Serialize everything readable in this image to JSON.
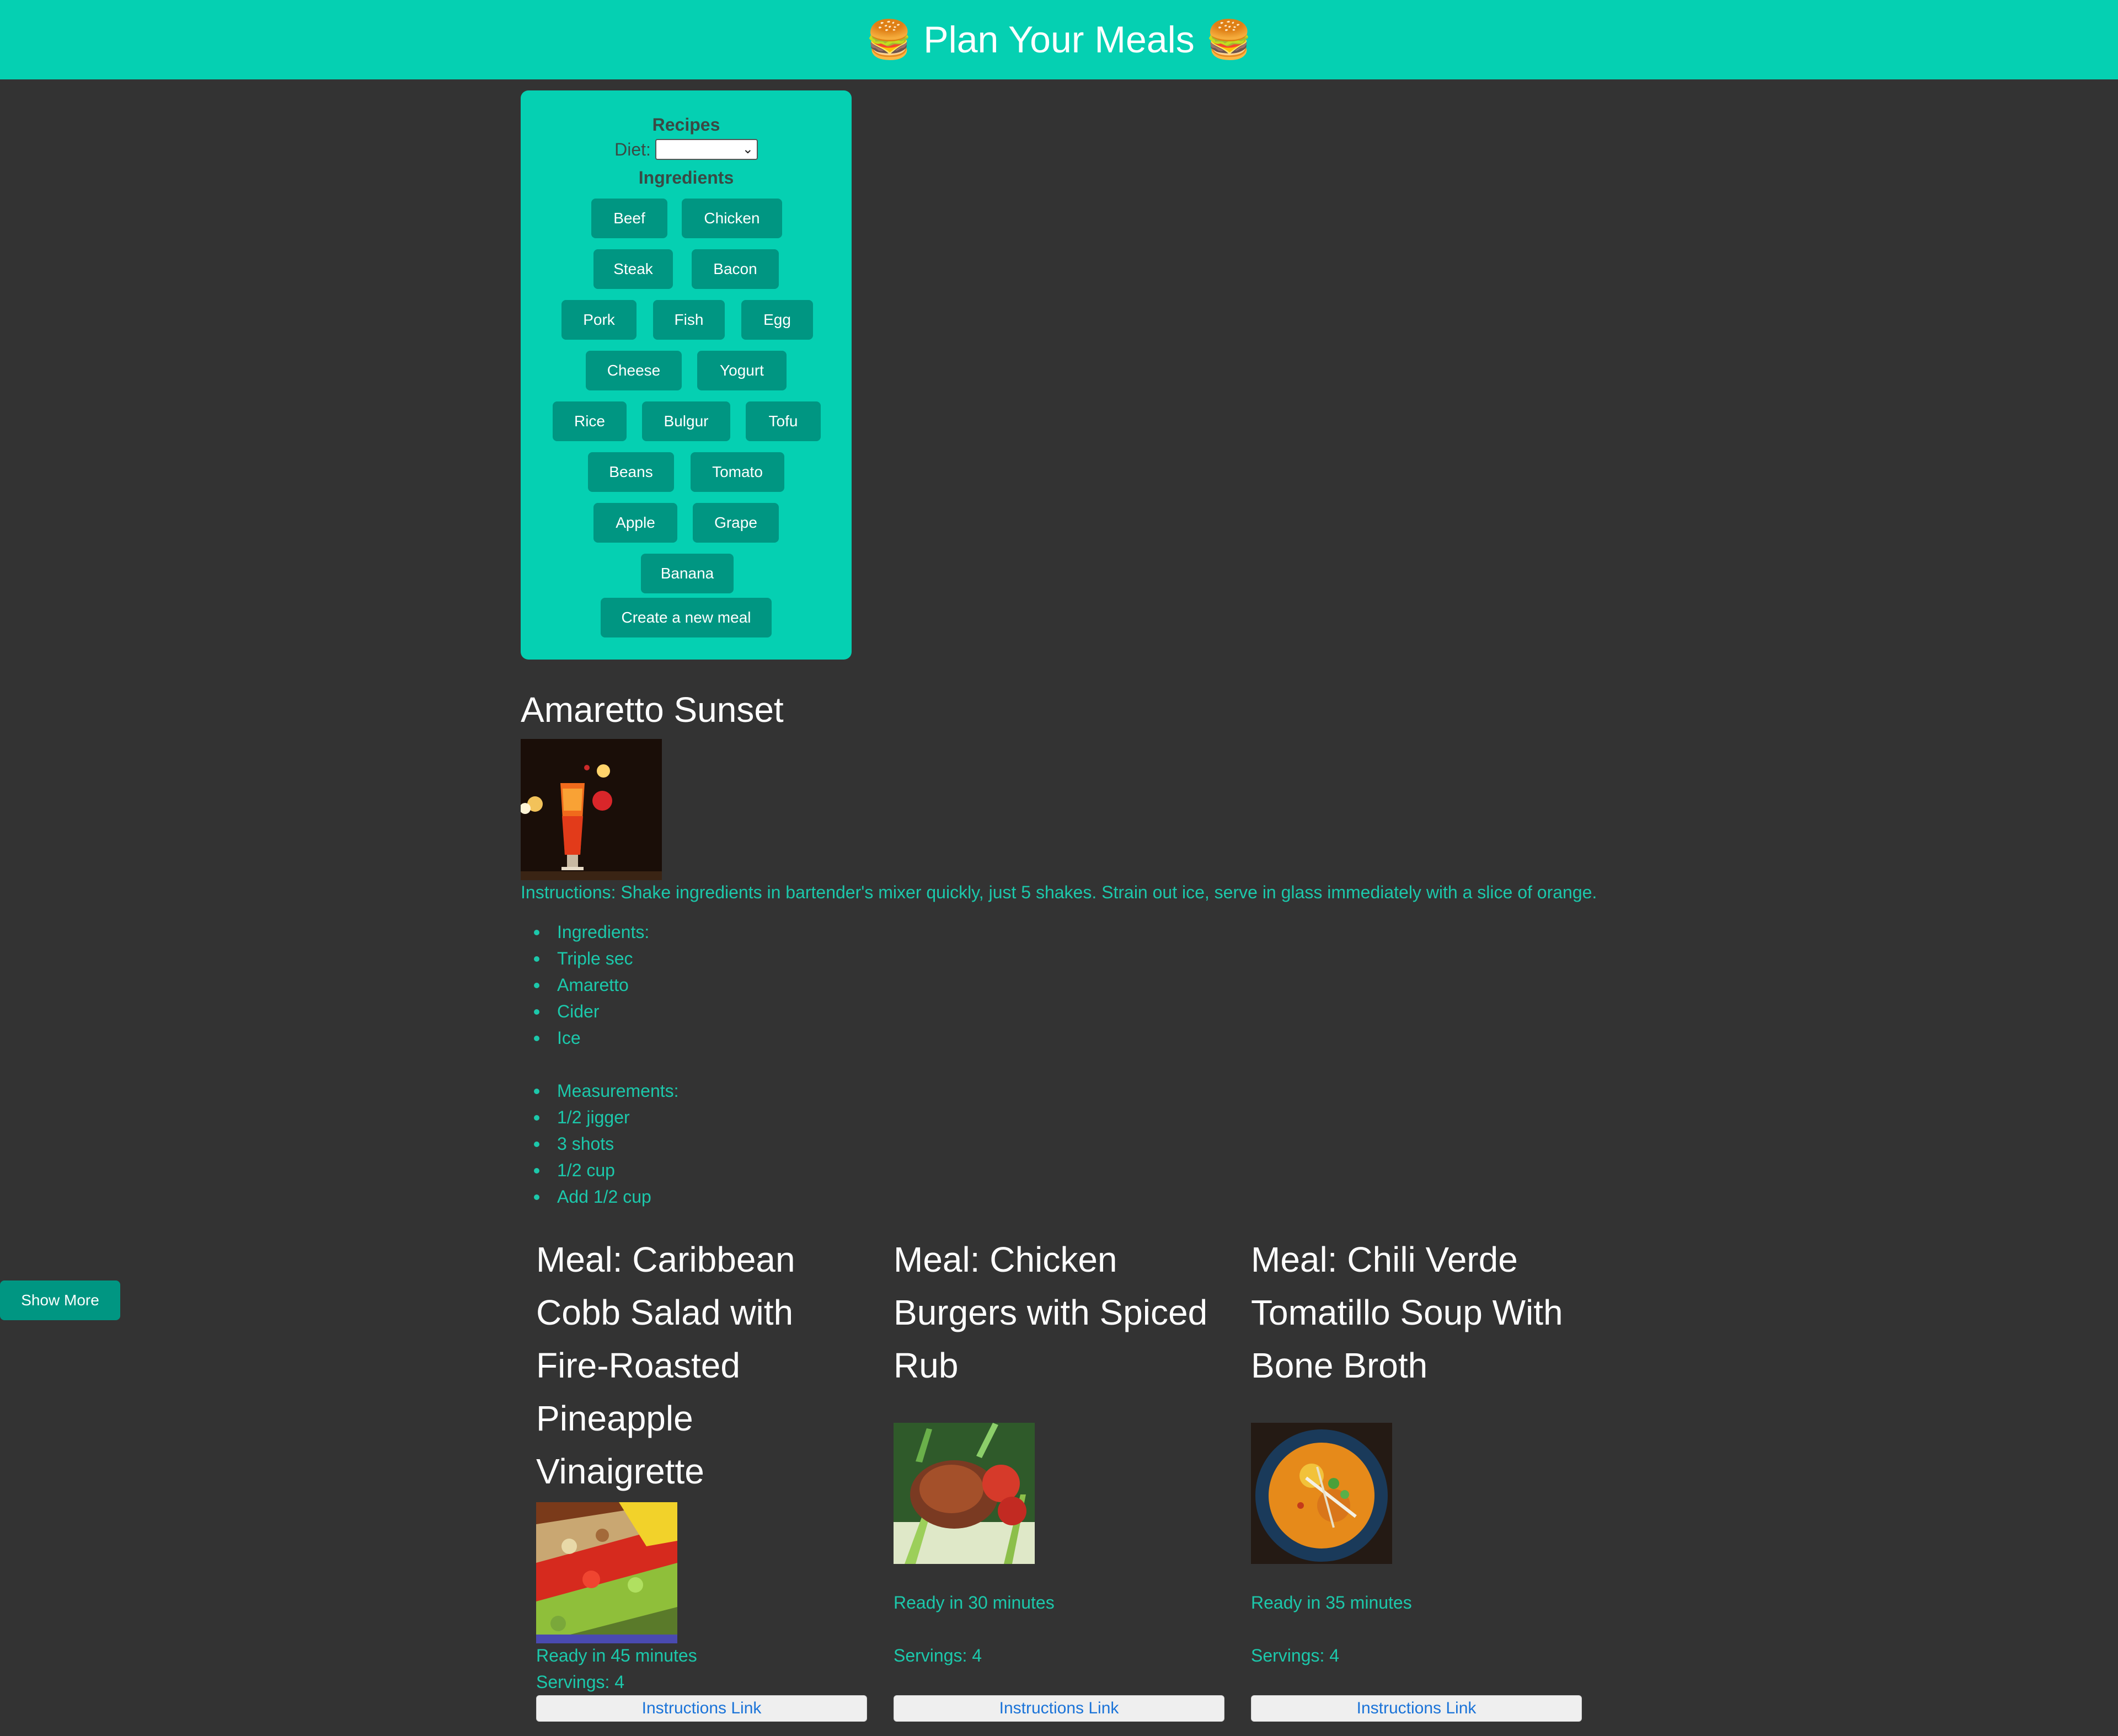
{
  "header": {
    "title": "Plan Your Meals",
    "icon": "burger-icon",
    "accent": "#05d0b2"
  },
  "panel": {
    "recipes_heading": "Recipes",
    "diet_label": "Diet:",
    "diet_value": "",
    "ingredients_heading": "Ingredients",
    "ingredients": [
      "Beef",
      "Chicken",
      "Steak",
      "Bacon",
      "Pork",
      "Fish",
      "Egg",
      "Cheese",
      "Yogurt",
      "Rice",
      "Bulgur",
      "Tofu",
      "Beans",
      "Tomato",
      "Apple",
      "Grape",
      "Banana"
    ],
    "create_button": "Create a new meal"
  },
  "recipe": {
    "title": "Amaretto Sunset",
    "instructions": "Instructions: Shake ingredients in bartender's mixer quickly, just 5 shakes. Strain out ice, serve in glass immediately with a slice of orange.",
    "ingredients": [
      "Ingredients:",
      "Triple sec",
      "Amaretto",
      "Cider",
      "Ice"
    ],
    "measurements": [
      "Measurements:",
      "1/2 jigger",
      "3 shots",
      "1/2 cup",
      "Add 1/2 cup"
    ]
  },
  "show_more": "Show More",
  "meals": [
    {
      "title": "Meal: Caribbean Cobb Salad with Fire-Roasted Pineapple Vinaigrette",
      "ready": "Ready in 45 minutes",
      "servings": "Servings: 4",
      "link": "Instructions Link"
    },
    {
      "title": "Meal: Chicken Burgers with Spiced Rub",
      "ready": "Ready in 30 minutes",
      "servings": "Servings: 4",
      "link": "Instructions Link"
    },
    {
      "title": "Meal: Chili Verde Tomatillo Soup With Bone Broth",
      "ready": "Ready in 35 minutes",
      "servings": "Servings: 4",
      "link": "Instructions Link"
    }
  ]
}
